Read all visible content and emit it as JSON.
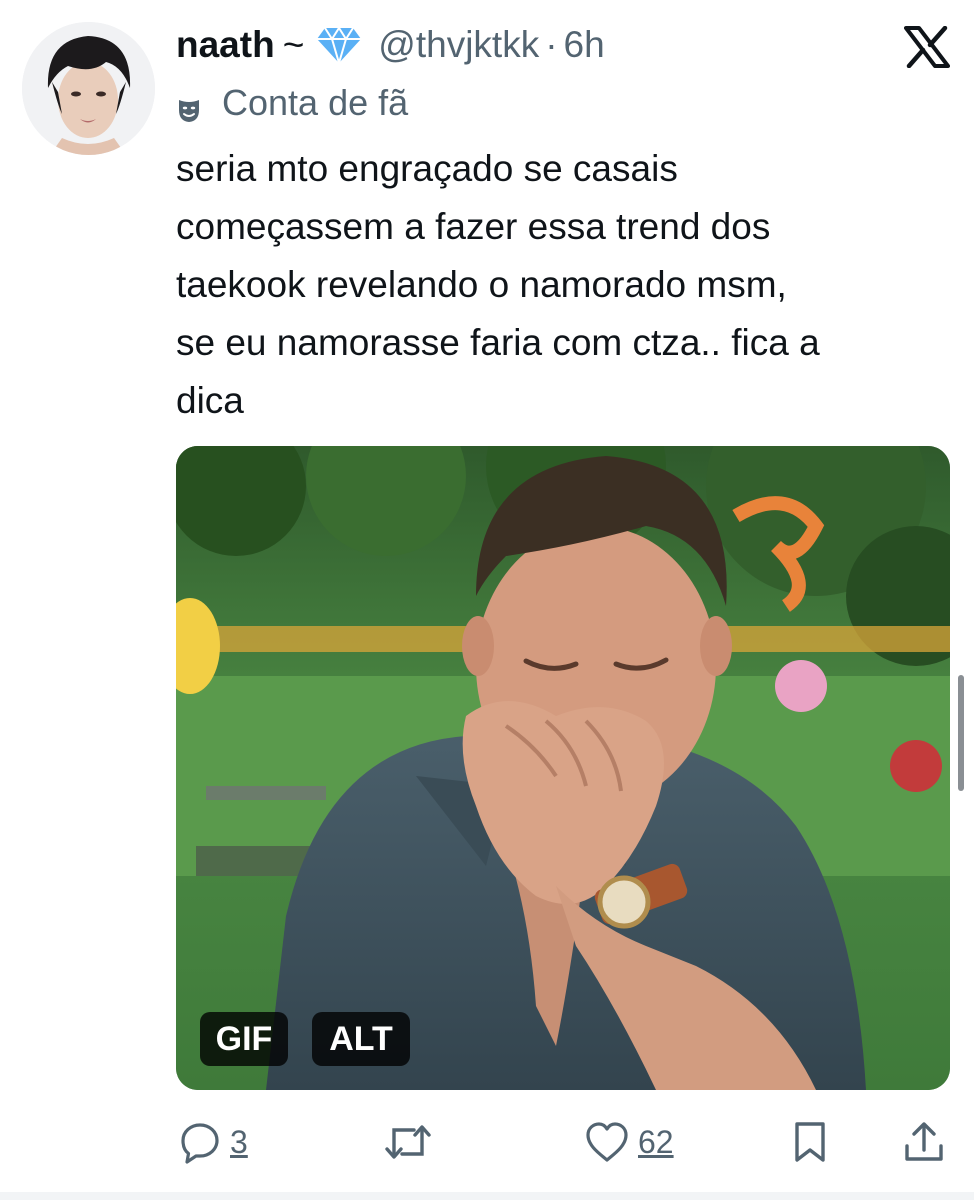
{
  "author": {
    "name": "naath",
    "name_suffix": "~",
    "handle": "@thvjktkk",
    "separator": "·",
    "time": "6h",
    "label": "Conta de fã",
    "verified_icon": "diamond-icon",
    "label_icon": "theater-mask-icon"
  },
  "platform": {
    "logo": "x-logo-icon"
  },
  "tweet": {
    "lines": [
      "seria mto engraçado se casais",
      "começassem a fazer essa trend dos",
      "taekook revelando o namorado msm,",
      "se eu namorasse faria com ctza.. fica a",
      "dica"
    ]
  },
  "media": {
    "gif_badge": "GIF",
    "alt_badge": "ALT"
  },
  "actions": {
    "replies": "3",
    "reposts": "",
    "likes": "62",
    "icons": [
      "reply-icon",
      "repost-icon",
      "like-icon",
      "bookmark-icon",
      "share-icon"
    ]
  },
  "colors": {
    "text": "#0f1419",
    "secondary": "#536471",
    "verified": "#5ab0f5"
  }
}
